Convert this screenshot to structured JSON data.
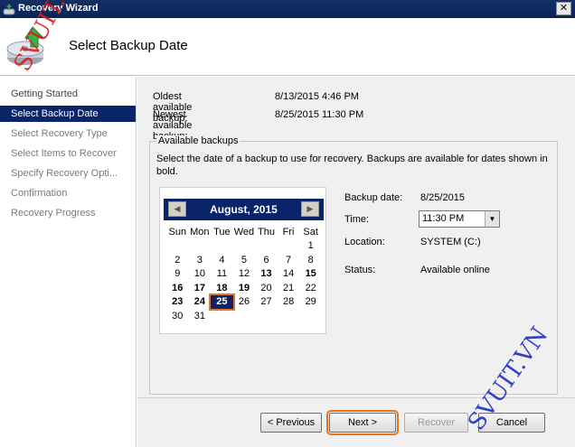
{
  "window": {
    "title": "Recovery Wizard",
    "close_glyph": "✕"
  },
  "header": {
    "page_title": "Select Backup Date"
  },
  "nav": {
    "items": [
      {
        "label": "Getting Started",
        "state": "done"
      },
      {
        "label": "Select Backup Date",
        "state": "active"
      },
      {
        "label": "Select Recovery Type",
        "state": "pending"
      },
      {
        "label": "Select Items to Recover",
        "state": "pending"
      },
      {
        "label": "Specify Recovery Opti...",
        "state": "pending"
      },
      {
        "label": "Confirmation",
        "state": "pending"
      },
      {
        "label": "Recovery Progress",
        "state": "pending"
      }
    ]
  },
  "backups": {
    "oldest_label": "Oldest available backup:",
    "oldest_value": "8/13/2015 4:46 PM",
    "newest_label": "Newest available backup:",
    "newest_value": "8/25/2015 11:30 PM"
  },
  "available": {
    "legend": "Available backups",
    "description": "Select the date of a backup to use for recovery. Backups are available for dates shown in bold."
  },
  "calendar": {
    "month_label": "August, 2015",
    "prev_glyph": "◀",
    "next_glyph": "▶",
    "weekdays": [
      "Sun",
      "Mon",
      "Tue",
      "Wed",
      "Thu",
      "Fri",
      "Sat"
    ],
    "weeks": [
      [
        "",
        "",
        "",
        "",
        "",
        "",
        "1"
      ],
      [
        "2",
        "3",
        "4",
        "5",
        "6",
        "7",
        "8"
      ],
      [
        "9",
        "10",
        "11",
        "12",
        "13",
        "14",
        "15"
      ],
      [
        "16",
        "17",
        "18",
        "19",
        "20",
        "21",
        "22"
      ],
      [
        "23",
        "24",
        "25",
        "26",
        "27",
        "28",
        "29"
      ],
      [
        "30",
        "31",
        "",
        "",
        "",
        "",
        ""
      ]
    ],
    "available_days": [
      "13",
      "15",
      "16",
      "17",
      "18",
      "19",
      "23",
      "24",
      "25"
    ],
    "selected_day": "25"
  },
  "details": {
    "date_label": "Backup date:",
    "date_value": "8/25/2015",
    "time_label": "Time:",
    "time_value": "11:30 PM",
    "location_label": "Location:",
    "location_value": "SYSTEM (C:)",
    "status_label": "Status:",
    "status_value": "Available online"
  },
  "buttons": {
    "previous": "< Previous",
    "next": "Next >",
    "recover": "Recover",
    "cancel": "Cancel"
  },
  "watermarks": {
    "top": "SVUIT.VN",
    "bottom": "SVUIT.VN"
  },
  "colors": {
    "accent": "#0a246a",
    "highlight": "#e8741f",
    "watermark_red": "#d42020",
    "watermark_blue": "#1d2fbd"
  }
}
